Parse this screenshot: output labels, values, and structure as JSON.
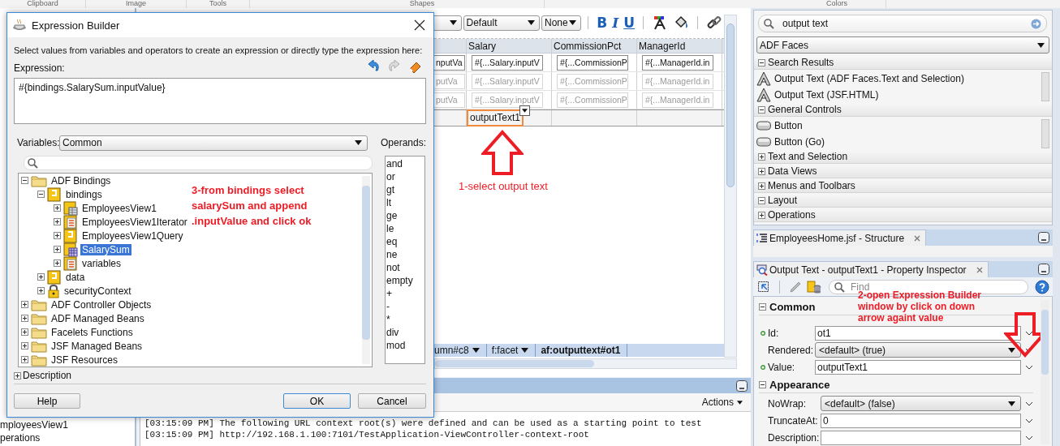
{
  "ribbon": {
    "groups": [
      "Clipboard",
      "Image",
      "Tools",
      "Shapes",
      "Colors"
    ]
  },
  "left_pane": {
    "items": [
      "mployeesView1",
      "perations"
    ]
  },
  "editor": {
    "toolbar": {
      "dropdowns": [
        "Default",
        "None"
      ],
      "format_buttons": [
        {
          "label": "B",
          "kind": "bold"
        },
        {
          "label": "I",
          "kind": "italic"
        },
        {
          "label": "U",
          "kind": "underline"
        }
      ]
    },
    "table": {
      "columns": [
        "",
        "Salary",
        "CommissionPct",
        "ManagerId"
      ],
      "rows": [
        {
          "muted": false,
          "cells": [
            "nputVa",
            "#{...Salary.inputV",
            "#{...CommissionP",
            "#{...ManagerId.in"
          ]
        },
        {
          "muted": true,
          "cells": [
            "putVa",
            "#{...Salary.inputV",
            "#{...CommissionP",
            "#{...ManagerId.in"
          ]
        },
        {
          "muted": true,
          "cells": [
            "putVa",
            "#{...Salary.inputV",
            "#{...CommissionP",
            "#{...ManagerId.in"
          ]
        }
      ],
      "footer": {
        "value": "outputText1",
        "selected": true
      }
    },
    "annotation": {
      "text": "1-select output text",
      "kind": "up-arrow"
    },
    "breadcrumbs": [
      {
        "label": "umn#c8",
        "current": false
      },
      {
        "label": "f:facet",
        "current": false
      },
      {
        "label": "af:outputtext#ot1",
        "current": true
      }
    ]
  },
  "log": {
    "actions": "Actions",
    "lines": [
      "[03:15:09 PM] The following URL context root(s) were defined and can be used as a starting point to test",
      "[03:15:09 PM] http://192.168.1.100:7101/TestApplication-ViewController-context-root"
    ]
  },
  "palette": {
    "search": {
      "value": "output text"
    },
    "library": "ADF Faces",
    "sections": [
      {
        "title": "Search Results",
        "expanded": true,
        "items": [
          {
            "label": "Output Text (ADF Faces.Text and Selection)",
            "kind": "text"
          },
          {
            "label": "Output Text (JSF.HTML)",
            "kind": "text"
          }
        ]
      },
      {
        "title": "General Controls",
        "expanded": true,
        "items": [
          {
            "label": "Button",
            "kind": "button"
          },
          {
            "label": "Button (Go)",
            "kind": "button"
          }
        ]
      },
      {
        "title": "Text and Selection",
        "expanded": false
      },
      {
        "title": "Data Views",
        "expanded": false
      },
      {
        "title": "Menus and Toolbars",
        "expanded": false
      },
      {
        "title": "Layout",
        "expanded": true
      },
      {
        "title": "Operations",
        "expanded": false
      }
    ]
  },
  "structure": {
    "tab": "EmployeesHome.jsf - Structure"
  },
  "inspector": {
    "tab": "Output Text - outputText1 - Property Inspector",
    "find_placeholder": "Find",
    "sections": [
      {
        "title": "Common",
        "expanded": true,
        "properties": [
          {
            "label": "Id:",
            "value": "ot1",
            "kind": "field",
            "set": true
          },
          {
            "label": "Rendered:",
            "value": "<default> (true)",
            "kind": "dropdown",
            "set": false
          },
          {
            "label": "Value:",
            "value": "outputText1",
            "kind": "field",
            "set": true
          }
        ]
      },
      {
        "title": "Appearance",
        "expanded": true,
        "properties": [
          {
            "label": "NoWrap:",
            "value": "<default> (false)",
            "kind": "dropdown",
            "set": false
          },
          {
            "label": "TruncateAt:",
            "value": "0",
            "kind": "field",
            "set": false
          },
          {
            "label": "Description:",
            "kind": "field",
            "set": false
          }
        ]
      }
    ],
    "annotation": {
      "text": "2-open Expression Builder window by click on down arrow againt value",
      "kind": "down-arrow"
    }
  },
  "dialog": {
    "title": "Expression Builder",
    "instruction": "Select values from variables and operators to create an expression or directly type the expression here:",
    "expression_label": "Expression:",
    "tools": [
      {
        "kind": "undo",
        "disabled": false
      },
      {
        "kind": "redo",
        "disabled": true
      },
      {
        "kind": "clear",
        "disabled": false
      }
    ],
    "expression": "#{bindings.SalarySum.inputValue}",
    "variables_label": "Variables:",
    "variables": "Common",
    "operands_label": "Operands:",
    "operands": [
      "and",
      "or",
      "gt",
      "lt",
      "ge",
      "le",
      "eq",
      "ne",
      "not",
      "empty",
      "+",
      "-",
      "*",
      "div",
      "mod"
    ],
    "tree": [
      {
        "label": "ADF Bindings",
        "kind": "folder",
        "expanded": true,
        "selected": false,
        "children": [
          {
            "label": "bindings",
            "kind": "container",
            "expanded": true,
            "selected": false,
            "children": [
              {
                "label": "EmployeesView1",
                "kind": "table",
                "expanded": false,
                "selected": false
              },
              {
                "label": "EmployeesView1Iterator",
                "kind": "list",
                "expanded": false,
                "selected": false
              },
              {
                "label": "EmployeesView1Query",
                "kind": "container",
                "expanded": false,
                "selected": false
              },
              {
                "label": "SalarySum",
                "kind": "attribute",
                "expanded": false,
                "selected": true
              },
              {
                "label": "variables",
                "kind": "list",
                "expanded": false,
                "selected": false
              }
            ]
          },
          {
            "label": "data",
            "kind": "container",
            "expanded": false,
            "selected": false
          },
          {
            "label": "securityContext",
            "kind": "lock",
            "expanded": false,
            "selected": false
          }
        ]
      },
      {
        "label": "ADF Controller Objects",
        "kind": "folder",
        "expanded": false,
        "selected": false
      },
      {
        "label": "ADF Managed Beans",
        "kind": "folder",
        "expanded": false,
        "selected": false
      },
      {
        "label": "Facelets Functions",
        "kind": "folder",
        "expanded": false,
        "selected": false
      },
      {
        "label": "JSF Managed Beans",
        "kind": "folder",
        "expanded": false,
        "selected": false
      },
      {
        "label": "JSF Resources",
        "kind": "folder",
        "expanded": false,
        "selected": false
      }
    ],
    "annotation": {
      "text": "3-from bindings select salarySum and append .inputValue and click ok"
    },
    "description": {
      "label": "Description",
      "expanded": false
    },
    "buttons": [
      {
        "label": "Help",
        "kind": "help"
      },
      {
        "label": "OK",
        "kind": "default"
      },
      {
        "label": "Cancel",
        "kind": "cancel"
      }
    ]
  }
}
